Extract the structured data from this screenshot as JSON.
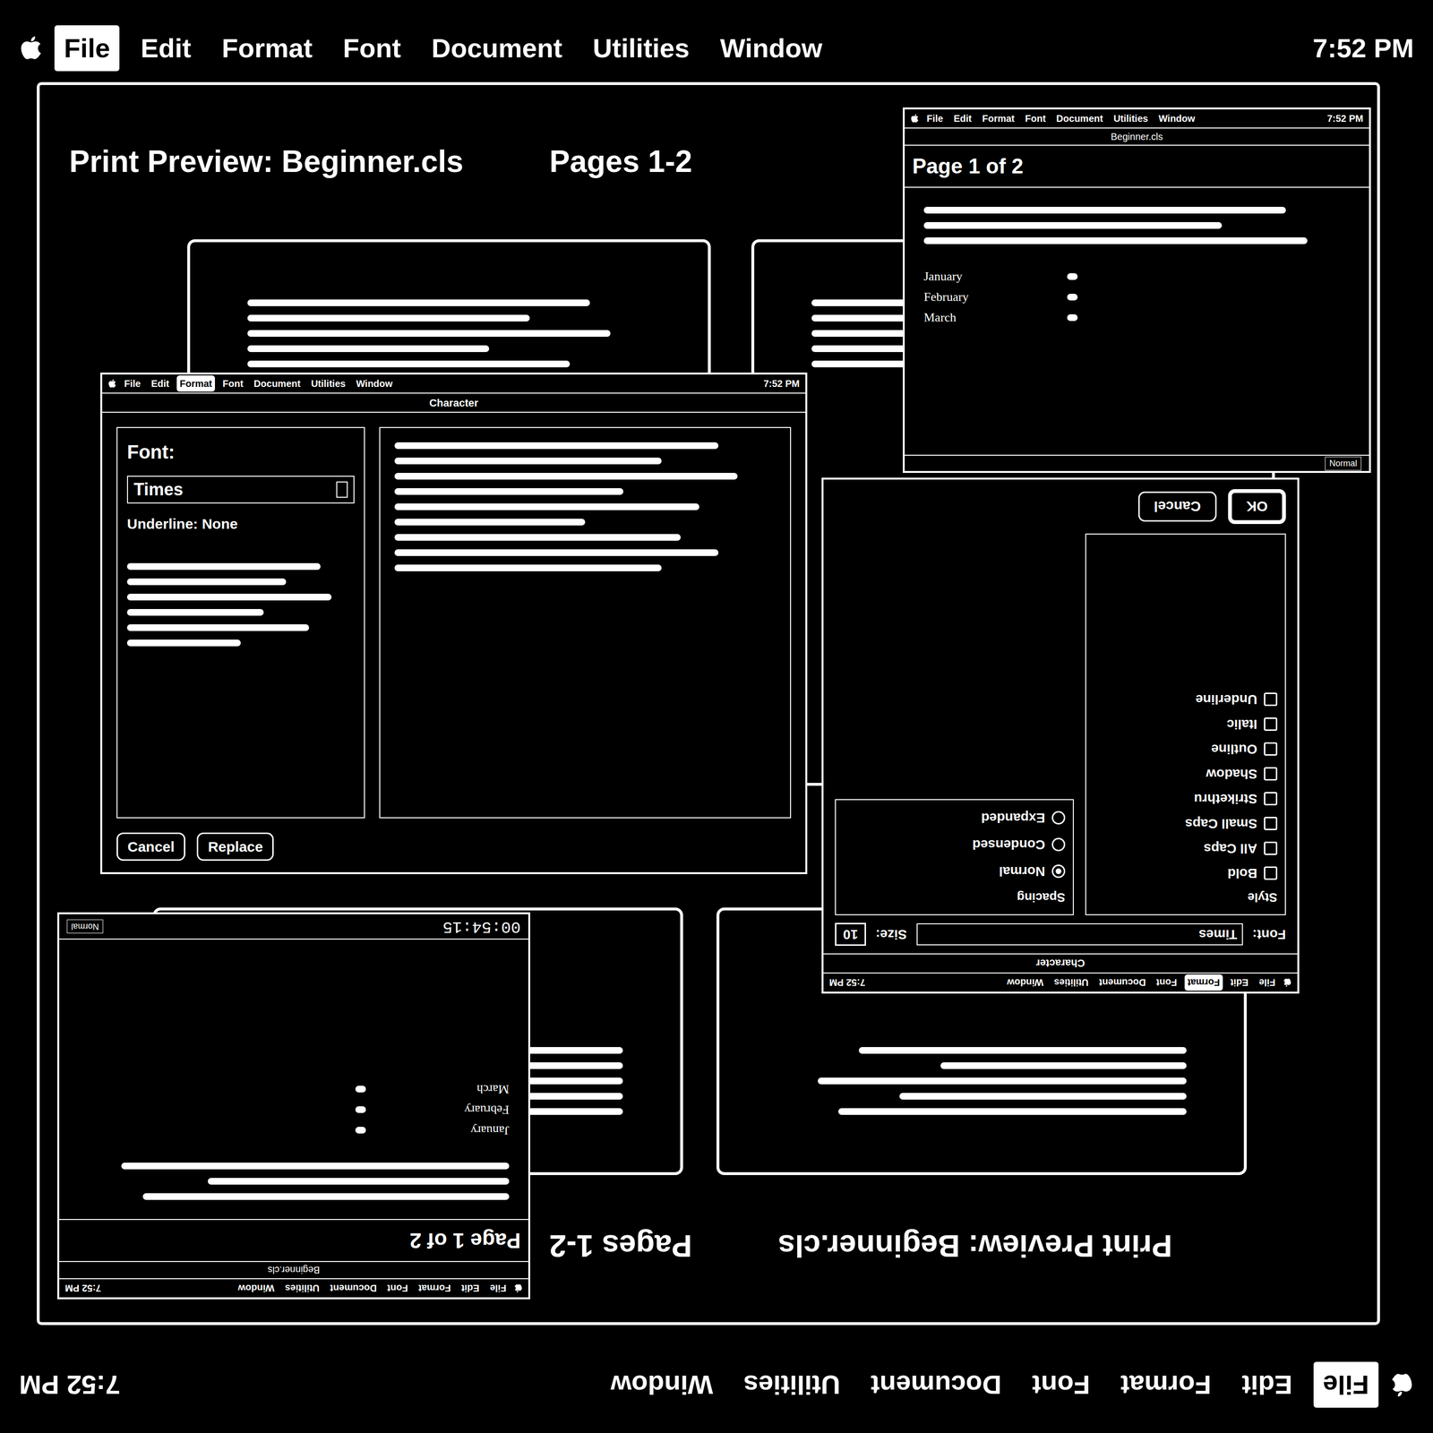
{
  "menu_bar": {
    "items": [
      {
        "label": "File",
        "selected": true
      },
      {
        "label": "Edit",
        "selected": false
      },
      {
        "label": "Format",
        "selected": false
      },
      {
        "label": "Font",
        "selected": false
      },
      {
        "label": "Document",
        "selected": false
      },
      {
        "label": "Utilities",
        "selected": false
      },
      {
        "label": "Window",
        "selected": false
      }
    ],
    "clock": "7:52 PM"
  },
  "preview": {
    "title": "Print Preview: Beginner.cls",
    "pages": "Pages 1-2"
  },
  "dialog_left": {
    "menu": [
      {
        "label": "File",
        "selected": false
      },
      {
        "label": "Edit",
        "selected": false
      },
      {
        "label": "Format",
        "selected": true
      },
      {
        "label": "Font",
        "selected": false
      },
      {
        "label": "Document",
        "selected": false
      },
      {
        "label": "Utilities",
        "selected": false
      },
      {
        "label": "Window",
        "selected": false
      }
    ],
    "clock": "7:52 PM",
    "title": "Character",
    "font_label": "Font:",
    "font_value": "Times",
    "underline": "Underline: None",
    "buttons": [
      "Cancel",
      "Replace"
    ]
  },
  "dialog_right": {
    "menu": [
      {
        "label": "File",
        "selected": false
      },
      {
        "label": "Edit",
        "selected": false
      },
      {
        "label": "Format",
        "selected": true
      },
      {
        "label": "Font",
        "selected": false
      },
      {
        "label": "Document",
        "selected": false
      },
      {
        "label": "Utilities",
        "selected": false
      },
      {
        "label": "Window",
        "selected": false
      }
    ],
    "clock": "7:52 PM",
    "title": "Character",
    "font_label": "Font:",
    "font_value": "Times",
    "size_label": "Size:",
    "size_value": "10",
    "styles_label": "Style",
    "styles": [
      {
        "label": "Bold",
        "checked": false
      },
      {
        "label": "All Caps",
        "checked": false
      },
      {
        "label": "Small Caps",
        "checked": false
      },
      {
        "label": "Strikethru",
        "checked": false
      },
      {
        "label": "Shadow",
        "checked": false
      },
      {
        "label": "Outline",
        "checked": false
      },
      {
        "label": "Italic",
        "checked": false
      },
      {
        "label": "Underline",
        "checked": false
      }
    ],
    "spacing_label": "Spacing",
    "spacing": [
      {
        "label": "Normal",
        "selected": true
      },
      {
        "label": "Condensed",
        "selected": false
      },
      {
        "label": "Expanded",
        "selected": false
      }
    ],
    "buttons": [
      {
        "label": "OK",
        "default": true
      },
      {
        "label": "Cancel",
        "default": false
      }
    ]
  },
  "mini_top": {
    "menu": [
      {
        "label": "File",
        "selected": false
      },
      {
        "label": "Edit",
        "selected": false
      },
      {
        "label": "Format",
        "selected": false
      },
      {
        "label": "Font",
        "selected": false
      },
      {
        "label": "Document",
        "selected": false
      },
      {
        "label": "Utilities",
        "selected": false
      },
      {
        "label": "Window",
        "selected": false
      }
    ],
    "clock": "7:52 PM",
    "title": "Beginner.cls",
    "page_label": "Page 1 of 2",
    "months": [
      "January",
      "February",
      "March"
    ],
    "status": "Normal"
  },
  "mini_bottom": {
    "menu": [
      {
        "label": "File",
        "selected": false
      },
      {
        "label": "Edit",
        "selected": false
      },
      {
        "label": "Format",
        "selected": false
      },
      {
        "label": "Font",
        "selected": false
      },
      {
        "label": "Document",
        "selected": false
      },
      {
        "label": "Utilities",
        "selected": false
      },
      {
        "label": "Window",
        "selected": false
      }
    ],
    "clock": "7:52 PM",
    "title": "Beginner.cls",
    "page_label": "Page 1 of 2",
    "months": [
      "January",
      "February",
      "March"
    ],
    "status": "Normal",
    "timestamp": "00:54:15"
  }
}
